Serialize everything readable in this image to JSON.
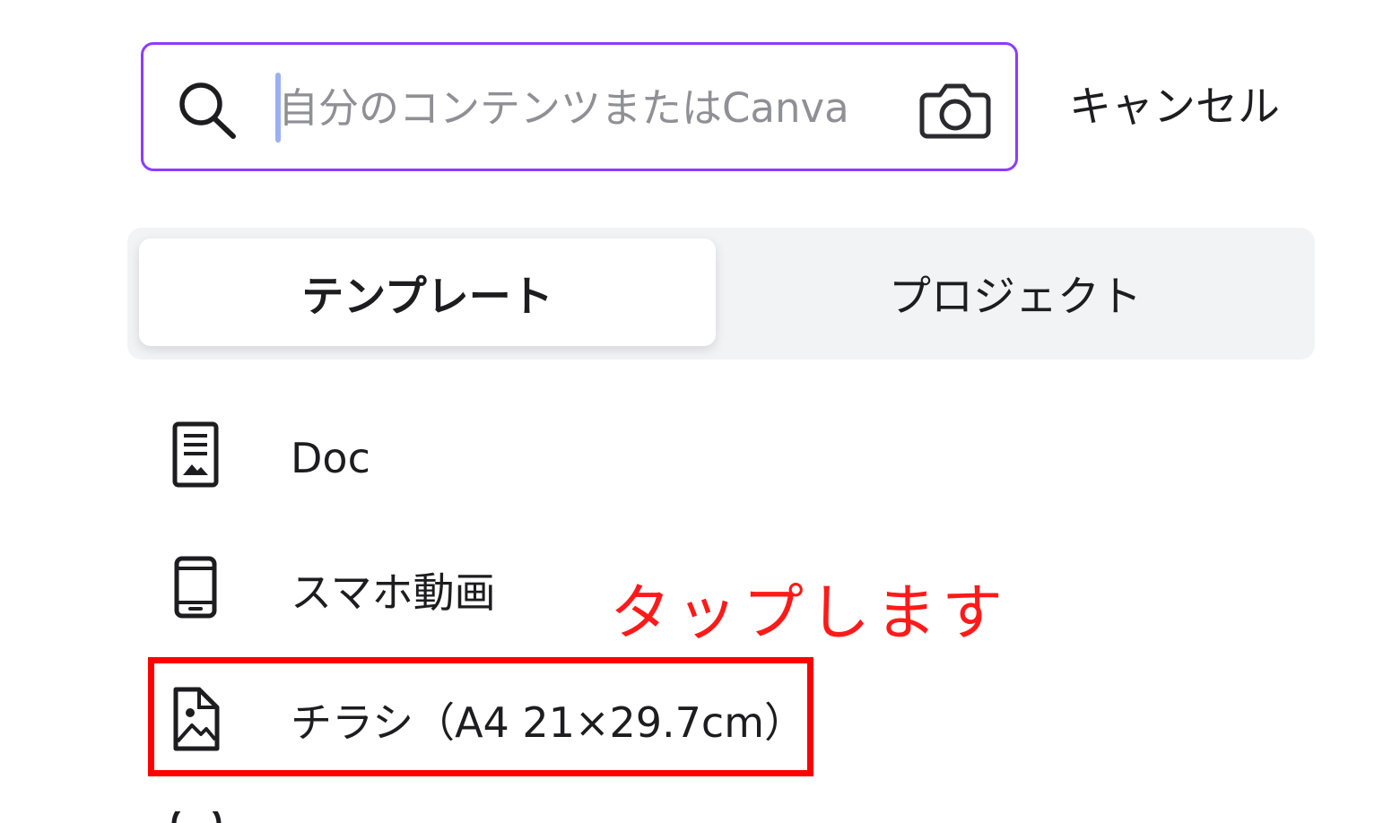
{
  "search": {
    "placeholder": "自分のコンテンツまたはCanva",
    "icon": "search-icon",
    "camera_icon": "camera-icon"
  },
  "header": {
    "cancel_label": "キャンセル"
  },
  "tabs": [
    {
      "label": "テンプレート",
      "active": true
    },
    {
      "label": "プロジェクト",
      "active": false
    }
  ],
  "list": [
    {
      "label": "Doc",
      "icon": "doc-icon"
    },
    {
      "label": "スマホ動画",
      "icon": "phone-icon"
    },
    {
      "label": "チラシ（A4 21×29.7cm）",
      "icon": "flyer-icon"
    }
  ],
  "annotation": {
    "text": "タップします",
    "color": "#ff0000"
  },
  "colors": {
    "accent": "#8b3dff",
    "annotation": "#ff0000",
    "tab_bg": "#f2f3f5"
  }
}
